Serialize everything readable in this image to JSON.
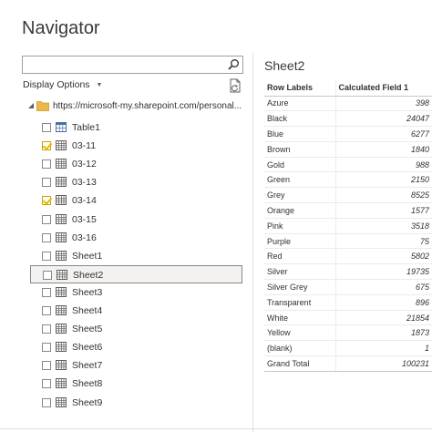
{
  "navigator": {
    "title": "Navigator",
    "search": {
      "value": "",
      "placeholder": ""
    },
    "display_options_label": "Display Options",
    "root": {
      "label": "https://microsoft-my.sharepoint.com/personal..."
    },
    "items": [
      {
        "label": "Table1",
        "type": "table",
        "checked": false,
        "selected": false
      },
      {
        "label": "03-11",
        "type": "sheet",
        "checked": true,
        "selected": false
      },
      {
        "label": "03-12",
        "type": "sheet",
        "checked": false,
        "selected": false
      },
      {
        "label": "03-13",
        "type": "sheet",
        "checked": false,
        "selected": false
      },
      {
        "label": "03-14",
        "type": "sheet",
        "checked": true,
        "selected": false
      },
      {
        "label": "03-15",
        "type": "sheet",
        "checked": false,
        "selected": false
      },
      {
        "label": "03-16",
        "type": "sheet",
        "checked": false,
        "selected": false
      },
      {
        "label": "Sheet1",
        "type": "sheet",
        "checked": false,
        "selected": false
      },
      {
        "label": "Sheet2",
        "type": "sheet",
        "checked": false,
        "selected": true
      },
      {
        "label": "Sheet3",
        "type": "sheet",
        "checked": false,
        "selected": false
      },
      {
        "label": "Sheet4",
        "type": "sheet",
        "checked": false,
        "selected": false
      },
      {
        "label": "Sheet5",
        "type": "sheet",
        "checked": false,
        "selected": false
      },
      {
        "label": "Sheet6",
        "type": "sheet",
        "checked": false,
        "selected": false
      },
      {
        "label": "Sheet7",
        "type": "sheet",
        "checked": false,
        "selected": false
      },
      {
        "label": "Sheet8",
        "type": "sheet",
        "checked": false,
        "selected": false
      },
      {
        "label": "Sheet9",
        "type": "sheet",
        "checked": false,
        "selected": false
      }
    ]
  },
  "preview": {
    "title": "Sheet2",
    "columns": [
      "Row Labels",
      "Calculated Field 1"
    ],
    "rows": [
      [
        "Azure",
        "398"
      ],
      [
        "Black",
        "24047"
      ],
      [
        "Blue",
        "6277"
      ],
      [
        "Brown",
        "1840"
      ],
      [
        "Gold",
        "988"
      ],
      [
        "Green",
        "2150"
      ],
      [
        "Grey",
        "8525"
      ],
      [
        "Orange",
        "1577"
      ],
      [
        "Pink",
        "3518"
      ],
      [
        "Purple",
        "75"
      ],
      [
        "Red",
        "5802"
      ],
      [
        "Silver",
        "19735"
      ],
      [
        "Silver Grey",
        "675"
      ],
      [
        "Transparent",
        "896"
      ],
      [
        "White",
        "21854"
      ],
      [
        "Yellow",
        "1873"
      ],
      [
        "(blank)",
        "1"
      ],
      [
        "Grand Total",
        "100231"
      ]
    ]
  },
  "colors": {
    "checkbox_check": "#e6b800",
    "folder": "#e8b84a",
    "selected_bg": "#f3f2f1"
  }
}
